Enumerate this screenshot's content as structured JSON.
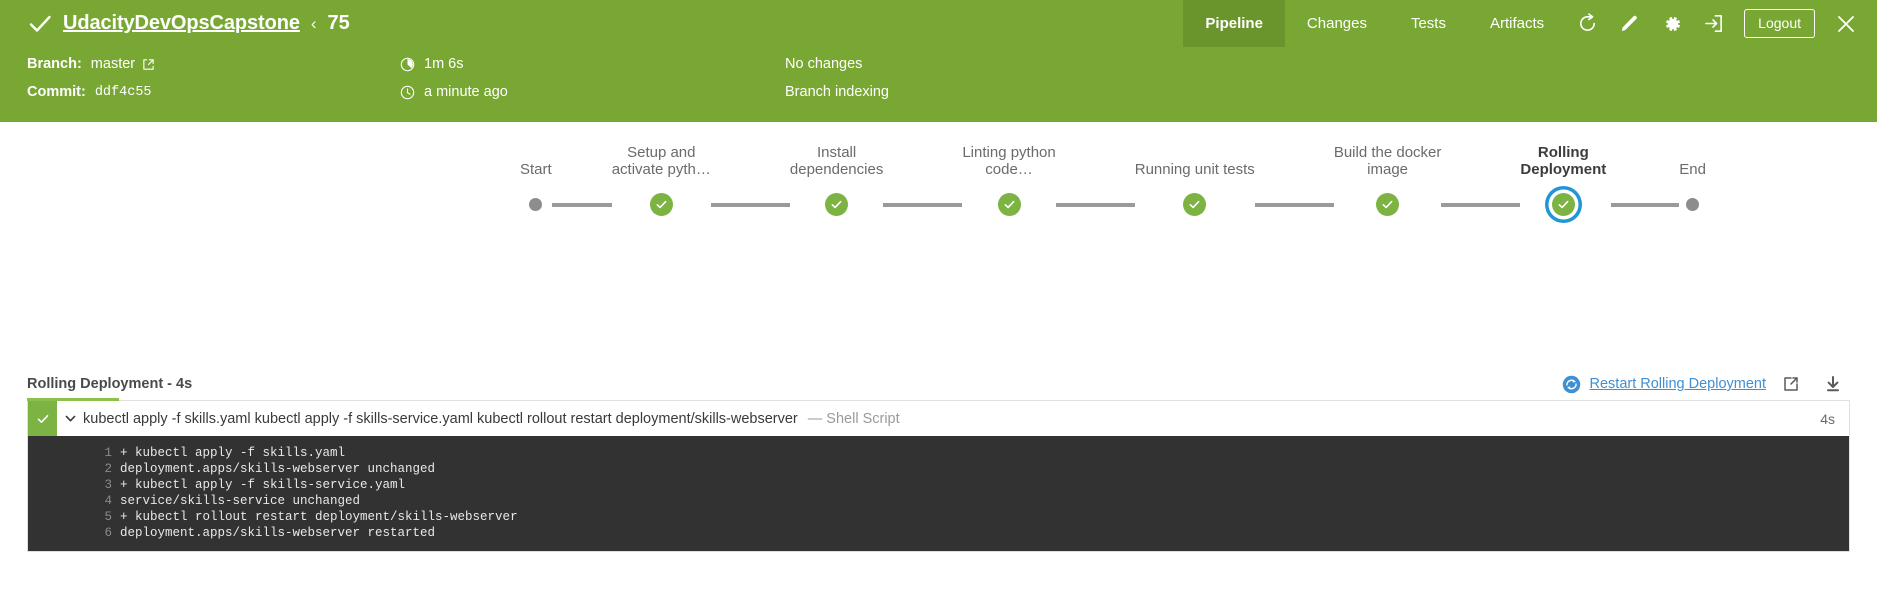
{
  "header": {
    "status_icon": "check-icon",
    "project_title": "UdacityDevOpsCapstone",
    "separator": "‹",
    "run_number": "75",
    "tabs": [
      {
        "label": "Pipeline",
        "active": true
      },
      {
        "label": "Changes",
        "active": false
      },
      {
        "label": "Tests",
        "active": false
      },
      {
        "label": "Artifacts",
        "active": false
      }
    ],
    "icons": [
      "replay-icon",
      "edit-icon",
      "gear-icon",
      "logout-arrow-icon"
    ],
    "logout_label": "Logout",
    "close_icon": "close-icon",
    "bg_color": "#78a833",
    "active_tab_color": "#69952c"
  },
  "meta": {
    "branch_label": "Branch:",
    "branch_value": "master",
    "commit_label": "Commit:",
    "commit_value": "ddf4c55",
    "duration": "1m 6s",
    "relative_time": "a minute ago",
    "changes": "No changes",
    "cause": "Branch indexing"
  },
  "pipeline": {
    "stages": [
      {
        "label": "Start",
        "type": "terminal",
        "selected": false
      },
      {
        "label": "Setup and\nactivate pyth…",
        "type": "success",
        "selected": false
      },
      {
        "label": "Install\ndependencies",
        "type": "success",
        "selected": false
      },
      {
        "label": "Linting python\ncode…",
        "type": "success",
        "selected": false
      },
      {
        "label": "Running unit tests",
        "type": "success",
        "selected": false
      },
      {
        "label": "Build the docker\nimage",
        "type": "success",
        "selected": false
      },
      {
        "label": "Rolling\nDeployment",
        "type": "success",
        "selected": true
      },
      {
        "label": "End",
        "type": "terminal",
        "selected": false
      }
    ],
    "success_color": "#7cb342",
    "terminal_color": "#8d8d8d",
    "selected_ring_color": "#2196d6"
  },
  "log": {
    "title": "Rolling Deployment - 4s",
    "restart_label": "Restart Rolling Deployment",
    "restart_icon": "restart-circle-icon",
    "open_external_icon": "external-link-icon",
    "download_icon": "download-icon",
    "link_color": "#3f8fd2",
    "step": {
      "status_icon": "check-icon",
      "chevron_icon": "chevron-down-icon",
      "command": "kubectl apply -f skills.yaml kubectl apply -f skills-service.yaml kubectl rollout restart deployment/skills-webserver",
      "type_label": "— Shell Script",
      "duration": "4s"
    },
    "lines": [
      {
        "n": "1",
        "text": "+ kubectl apply -f skills.yaml"
      },
      {
        "n": "2",
        "text": "deployment.apps/skills-webserver unchanged"
      },
      {
        "n": "3",
        "text": "+ kubectl apply -f skills-service.yaml"
      },
      {
        "n": "4",
        "text": "service/skills-service unchanged"
      },
      {
        "n": "5",
        "text": "+ kubectl rollout restart deployment/skills-webserver"
      },
      {
        "n": "6",
        "text": "deployment.apps/skills-webserver restarted"
      }
    ]
  }
}
